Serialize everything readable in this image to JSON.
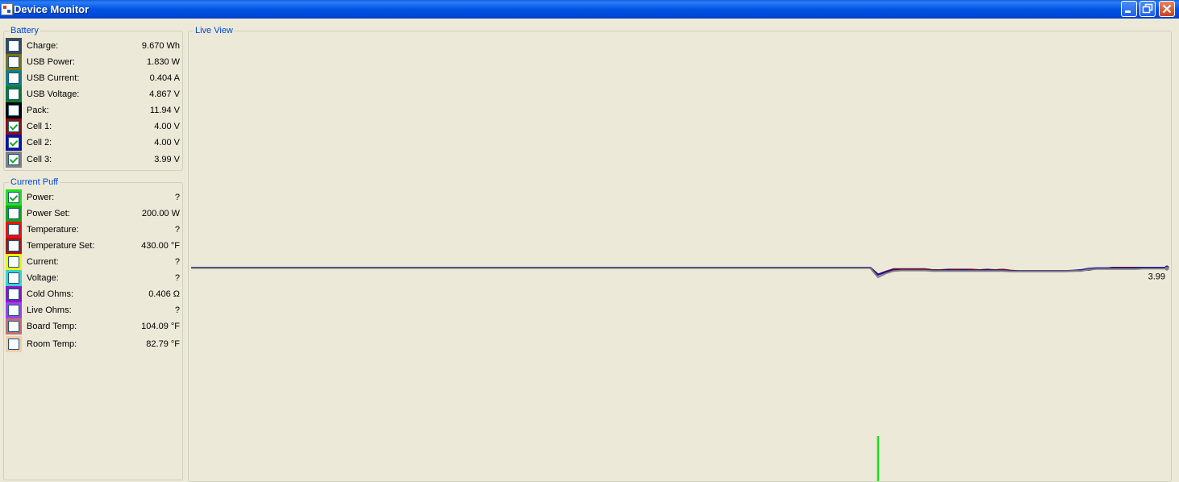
{
  "window": {
    "title": "Device Monitor",
    "buttons": {
      "minimize": "minimize",
      "maximize": "restore",
      "close": "close"
    }
  },
  "battery": {
    "legend": "Battery",
    "rows": [
      {
        "label": "Charge:",
        "value": "9.670 Wh",
        "color": "#3c4c55",
        "checked": false
      },
      {
        "label": "USB Power:",
        "value": "1.830 W",
        "color": "#7b7217",
        "checked": false
      },
      {
        "label": "USB Current:",
        "value": "0.404 A",
        "color": "#11807e",
        "checked": false
      },
      {
        "label": "USB Voltage:",
        "value": "4.867 V",
        "color": "#0f7a2e",
        "checked": false
      },
      {
        "label": "Pack:",
        "value": "11.94 V",
        "color": "#000000",
        "checked": false
      },
      {
        "label": "Cell 1:",
        "value": "4.00 V",
        "color": "#8c1010",
        "checked": true
      },
      {
        "label": "Cell 2:",
        "value": "4.00 V",
        "color": "#1010a8",
        "checked": true
      },
      {
        "label": "Cell 3:",
        "value": "3.99 V",
        "color": "#808080",
        "checked": true
      }
    ]
  },
  "current_puff": {
    "legend": "Current Puff",
    "rows": [
      {
        "label": "Power:",
        "value": "?",
        "color": "#1ee01e",
        "checked": true
      },
      {
        "label": "Power Set:",
        "value": "200.00 W",
        "color": "#13a813",
        "checked": false
      },
      {
        "label": "Temperature:",
        "value": "?",
        "color": "#ee1111",
        "checked": false
      },
      {
        "label": "Temperature Set:",
        "value": "430.00 °F",
        "color": "#a81616",
        "checked": false
      },
      {
        "label": "Current:",
        "value": "?",
        "color": "#f4f400",
        "checked": false
      },
      {
        "label": "Voltage:",
        "value": "?",
        "color": "#38d0d0",
        "checked": false
      },
      {
        "label": "Cold Ohms:",
        "value": "0.406 Ω",
        "color": "#8a16c8",
        "checked": false
      },
      {
        "label": "Live Ohms:",
        "value": "?",
        "color": "#9a44e8",
        "checked": false
      },
      {
        "label": "Board Temp:",
        "value": "104.09 °F",
        "color": "#c07070",
        "checked": false
      },
      {
        "label": "Room Temp:",
        "value": "82.79 °F",
        "color": "#f2cfa8",
        "checked": false
      }
    ]
  },
  "live_view": {
    "legend": "Live View"
  },
  "chart_data": {
    "type": "line",
    "value_label": "3.99",
    "series": [
      {
        "color": "#8c1010",
        "values": [
          4.0,
          4.0,
          4.0,
          4.0,
          4.0,
          4.0,
          4.0,
          4.0,
          4.0,
          4.0,
          4.0,
          4.0,
          4.0,
          4.0,
          4.0,
          4.0,
          4.0,
          4.0,
          4.0,
          4.0,
          4.0,
          4.0,
          4.0,
          4.0,
          4.0,
          4.0,
          4.0,
          4.0,
          4.0,
          4.0,
          4.0,
          4.0,
          4.0,
          4.0,
          4.0,
          4.0,
          4.0,
          4.0,
          4.0,
          4.0,
          4.0,
          4.0,
          4.0,
          4.0,
          4.0,
          4.0,
          4.0,
          4.0,
          4.0,
          4.0,
          4.0,
          4.0,
          4.0,
          4.0,
          4.0,
          4.0,
          4.0,
          4.0,
          4.0,
          4.0,
          4.0,
          4.0,
          4.0,
          4.0,
          4.0,
          4.0,
          4.0,
          4.0,
          4.0,
          4.0,
          4.0,
          4.0,
          4.0,
          4.0,
          4.0,
          4.0,
          4.0,
          4.0,
          4.0,
          4.0,
          4.0,
          4.0,
          4.0,
          4.0,
          4.0,
          4.0,
          4.0,
          4.0,
          3.86,
          3.92,
          3.97,
          3.97,
          3.97,
          3.97,
          3.97,
          3.95,
          3.95,
          3.96,
          3.96,
          3.96,
          3.96,
          3.95,
          3.96,
          3.95,
          3.96,
          3.94,
          3.93,
          3.93,
          3.93,
          3.93,
          3.93,
          3.93,
          3.93,
          3.93,
          3.95,
          3.95,
          3.98,
          3.98,
          4.0,
          4.0,
          4.0,
          4.0,
          4.0,
          4.0,
          4.0,
          4.0
        ]
      },
      {
        "color": "#1010a8",
        "values": [
          4.0,
          4.0,
          4.0,
          4.0,
          4.0,
          4.0,
          4.0,
          4.0,
          4.0,
          4.0,
          4.0,
          4.0,
          4.0,
          4.0,
          4.0,
          4.0,
          4.0,
          4.0,
          4.0,
          4.0,
          4.0,
          4.0,
          4.0,
          4.0,
          4.0,
          4.0,
          4.0,
          4.0,
          4.0,
          4.0,
          4.0,
          4.0,
          4.0,
          4.0,
          4.0,
          4.0,
          4.0,
          4.0,
          4.0,
          4.0,
          4.0,
          4.0,
          4.0,
          4.0,
          4.0,
          4.0,
          4.0,
          4.0,
          4.0,
          4.0,
          4.0,
          4.0,
          4.0,
          4.0,
          4.0,
          4.0,
          4.0,
          4.0,
          4.0,
          4.0,
          4.0,
          4.0,
          4.0,
          4.0,
          4.0,
          4.0,
          4.0,
          4.0,
          4.0,
          4.0,
          4.0,
          4.0,
          4.0,
          4.0,
          4.0,
          4.0,
          4.0,
          4.0,
          4.0,
          4.0,
          4.0,
          4.0,
          4.0,
          4.0,
          4.0,
          4.0,
          4.0,
          4.0,
          3.85,
          3.91,
          3.95,
          3.95,
          3.95,
          3.95,
          3.95,
          3.94,
          3.94,
          3.95,
          3.94,
          3.95,
          3.94,
          3.94,
          3.95,
          3.94,
          3.94,
          3.93,
          3.93,
          3.93,
          3.93,
          3.93,
          3.93,
          3.93,
          3.93,
          3.94,
          3.95,
          3.98,
          3.99,
          3.99,
          3.99,
          3.99,
          3.99,
          3.99,
          4.0,
          4.0,
          4.0,
          4.0
        ]
      },
      {
        "color": "#808080",
        "values": [
          3.99,
          3.99,
          3.99,
          3.99,
          3.99,
          3.99,
          3.99,
          3.99,
          3.99,
          3.99,
          3.99,
          3.99,
          3.99,
          3.99,
          3.99,
          3.99,
          3.99,
          3.99,
          3.99,
          3.99,
          3.99,
          3.99,
          3.99,
          3.99,
          3.99,
          3.99,
          3.99,
          3.99,
          3.99,
          3.99,
          3.99,
          3.99,
          3.99,
          3.99,
          3.99,
          3.99,
          3.99,
          3.99,
          3.99,
          3.99,
          3.99,
          3.99,
          3.99,
          3.99,
          3.99,
          3.99,
          3.99,
          3.99,
          3.99,
          3.99,
          3.99,
          3.99,
          3.99,
          3.99,
          3.99,
          3.99,
          3.99,
          3.99,
          3.99,
          3.99,
          3.99,
          3.99,
          3.99,
          3.99,
          3.99,
          3.99,
          3.99,
          3.99,
          3.99,
          3.99,
          3.99,
          3.99,
          3.99,
          3.99,
          3.99,
          3.99,
          3.99,
          3.99,
          3.99,
          3.99,
          3.99,
          3.99,
          3.99,
          3.99,
          3.99,
          3.99,
          3.99,
          3.99,
          3.8,
          3.88,
          3.93,
          3.94,
          3.94,
          3.94,
          3.94,
          3.93,
          3.93,
          3.93,
          3.93,
          3.93,
          3.93,
          3.93,
          3.93,
          3.93,
          3.93,
          3.92,
          3.92,
          3.92,
          3.92,
          3.92,
          3.92,
          3.92,
          3.92,
          3.93,
          3.93,
          3.96,
          3.97,
          3.97,
          3.97,
          3.97,
          3.97,
          3.97,
          3.98,
          3.98,
          3.98,
          3.98
        ]
      }
    ],
    "marker": {
      "series": "Power",
      "color": "#1ee01e",
      "index": 88
    }
  }
}
